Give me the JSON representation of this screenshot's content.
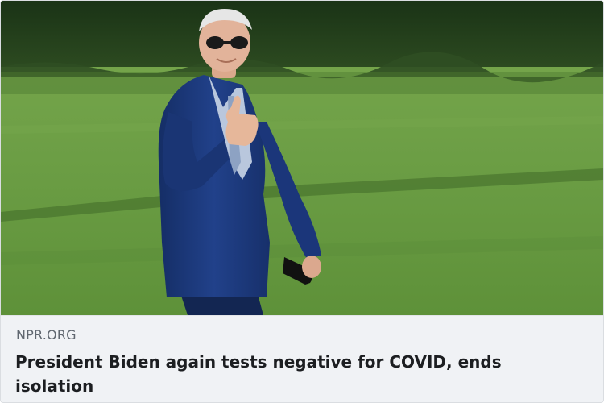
{
  "link_preview": {
    "domain": "NPR.ORG",
    "headline": "President Biden again tests negative for COVID, ends isolation"
  },
  "colors": {
    "lawn": "#6c9e45",
    "hedge": "#1f3a19",
    "suit": "#1d3a7a",
    "caption_bg": "#f0f2f5",
    "domain_text": "#606770",
    "headline_text": "#1c1e21"
  }
}
